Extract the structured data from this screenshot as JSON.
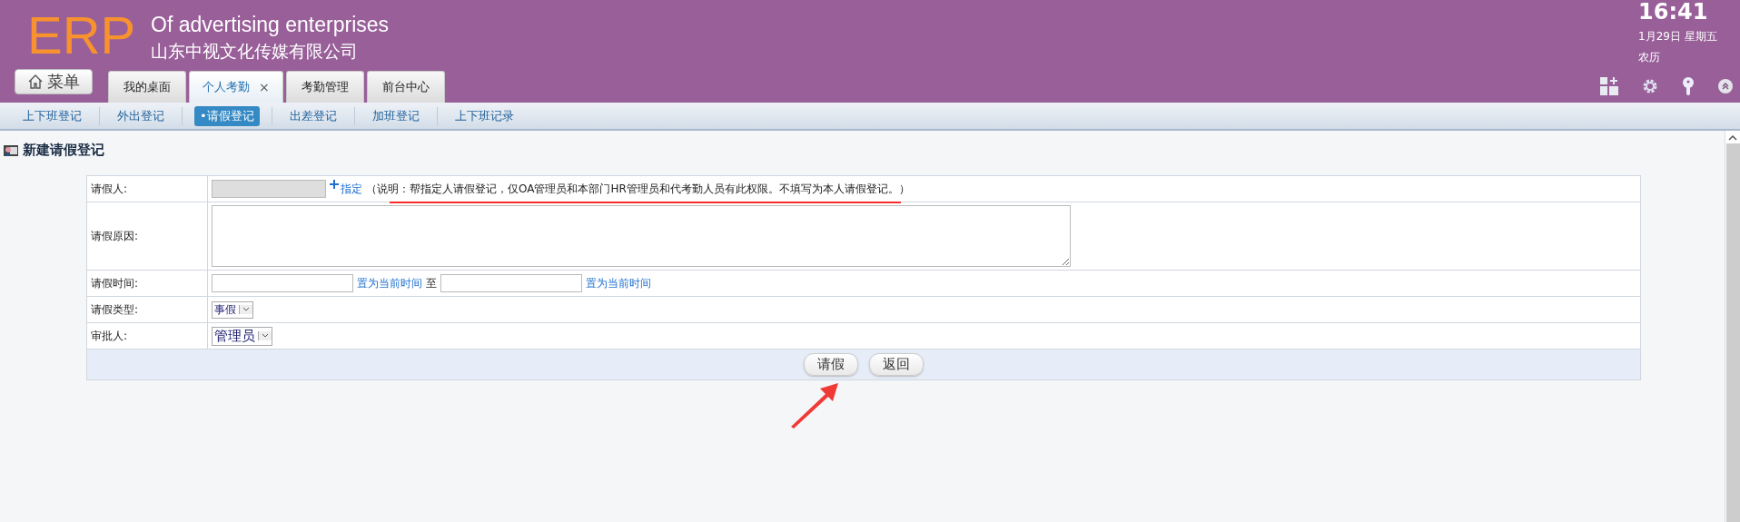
{
  "header": {
    "logo": "ERP",
    "slogan": "Of advertising enterprises",
    "company": "山东中视文化传媒有限公司",
    "menu_button": {
      "label": "菜单"
    },
    "tabs": [
      {
        "label": "我的桌面",
        "selected": false
      },
      {
        "label": "个人考勤",
        "selected": true,
        "close": "×"
      },
      {
        "label": "考勤管理",
        "selected": false
      },
      {
        "label": "前台中心",
        "selected": false
      }
    ],
    "clock": {
      "time": "16:41",
      "date": "1月29日 星期五",
      "lunar": "农历"
    }
  },
  "subnav": [
    {
      "label": "上下班登记",
      "selected": false
    },
    {
      "label": "外出登记",
      "selected": false
    },
    {
      "label": "•请假登记",
      "selected": true
    },
    {
      "label": "出差登记",
      "selected": false
    },
    {
      "label": "加班登记",
      "selected": false
    },
    {
      "label": "上下班记录",
      "selected": false
    }
  ],
  "page_title": "新建请假登记",
  "form": {
    "rows": [
      {
        "kind": "picker",
        "label": "请假人:",
        "link": "指定",
        "note": "（说明：帮指定人请假登记，仅OA管理员和本部门HR管理员和代考勤人员有此权限。不填写为本人请假登记。）",
        "highlighted": true
      },
      {
        "kind": "textarea",
        "label": "请假原因:"
      },
      {
        "kind": "range",
        "label": "请假时间:",
        "now_link": "置为当前时间",
        "separator": "至",
        "now_link_2": "置为当前时间"
      },
      {
        "kind": "select",
        "label": "请假类型:",
        "value": "事假"
      },
      {
        "kind": "select",
        "label": "审批人:",
        "value": "管理员"
      }
    ],
    "buttons": [
      {
        "label": "请假",
        "pointed": true
      },
      {
        "label": "返回",
        "pointed": false
      }
    ]
  }
}
